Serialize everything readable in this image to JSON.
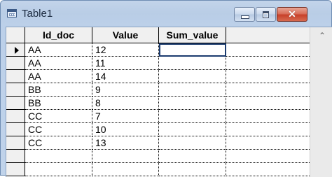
{
  "window": {
    "title": "Table1"
  },
  "titlebar_buttons": {
    "close_glyph": "✕"
  },
  "grid": {
    "columns": [
      "Id_doc",
      "Value",
      "Sum_value",
      ""
    ],
    "rows": [
      [
        "AA",
        "12",
        "",
        ""
      ],
      [
        "AA",
        "11",
        "",
        ""
      ],
      [
        "AA",
        "14",
        "",
        ""
      ],
      [
        "BB",
        "9",
        "",
        ""
      ],
      [
        "BB",
        "8",
        "",
        ""
      ],
      [
        "CC",
        "7",
        "",
        ""
      ],
      [
        "CC",
        "10",
        "",
        ""
      ],
      [
        "CC",
        "13",
        "",
        ""
      ],
      [
        "",
        "",
        "",
        ""
      ],
      [
        "",
        "",
        "",
        ""
      ]
    ],
    "current_row": 0,
    "active_column": 2
  },
  "scrollbar": {
    "up_glyph": "⌃"
  }
}
